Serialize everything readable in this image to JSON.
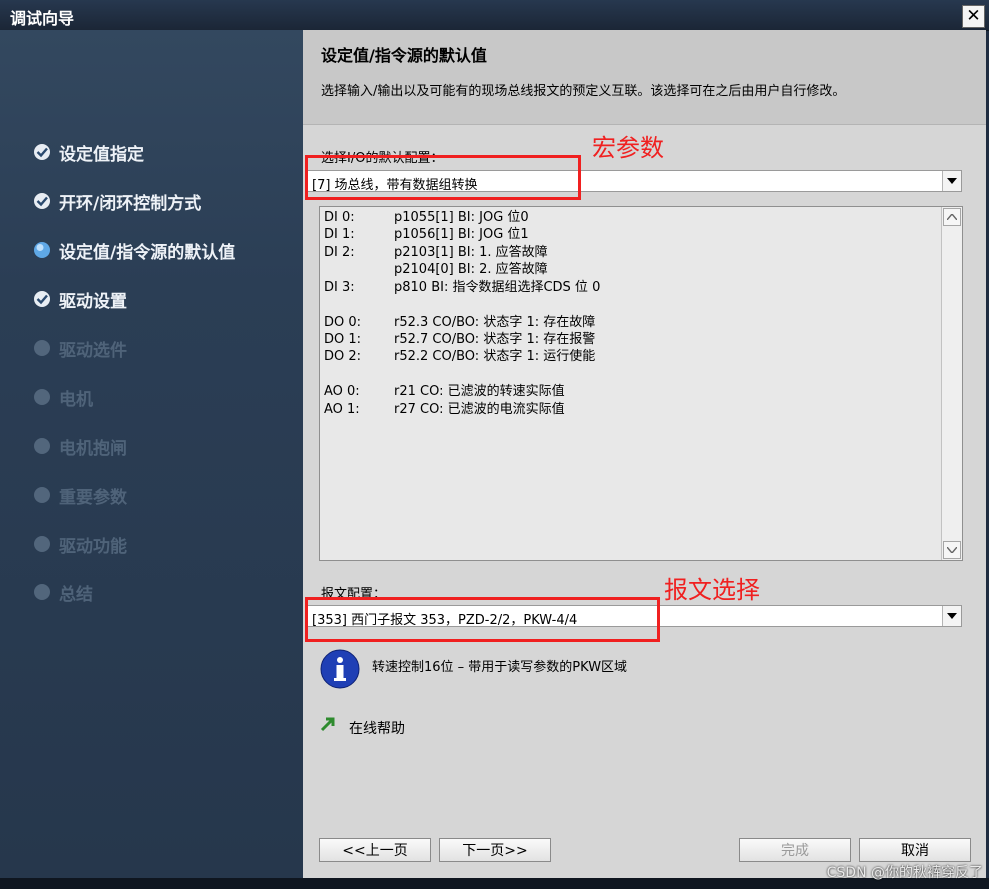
{
  "window": {
    "title": "调试向导",
    "close_label": "✕"
  },
  "sidebar": {
    "items": [
      {
        "label": "设定值指定",
        "state": "done",
        "icon": "checkmark-icon"
      },
      {
        "label": "开环/闭环控制方式",
        "state": "done",
        "icon": "checkmark-icon"
      },
      {
        "label": "设定值/指令源的默认值",
        "state": "current",
        "icon": "current-step-dot-icon"
      },
      {
        "label": "驱动设置",
        "state": "done",
        "icon": "checkmark-icon"
      },
      {
        "label": "驱动选件",
        "state": "disabled",
        "icon": "pending-dot-icon"
      },
      {
        "label": "电机",
        "state": "disabled",
        "icon": "pending-dot-icon"
      },
      {
        "label": "电机抱闸",
        "state": "disabled",
        "icon": "pending-dot-icon"
      },
      {
        "label": "重要参数",
        "state": "disabled",
        "icon": "pending-dot-icon"
      },
      {
        "label": "驱动功能",
        "state": "disabled",
        "icon": "pending-dot-icon"
      },
      {
        "label": "总结",
        "state": "disabled",
        "icon": "pending-dot-icon"
      }
    ]
  },
  "main": {
    "title": "设定值/指令源的默认值",
    "description": "选择输入/输出以及可能有的现场总线报文的预定义互联。该选择可在之后由用户自行修改。",
    "io_config": {
      "label": "选择I/O的默认配置：",
      "value": "[7] 场总线，带有数据组转换"
    },
    "io_list": [
      {
        "label": "DI 0:",
        "value": "p1055[1] BI: JOG 位0"
      },
      {
        "label": "DI 1:",
        "value": "p1056[1] BI: JOG 位1"
      },
      {
        "label": "DI 2:",
        "value": "p2103[1] BI: 1. 应答故障"
      },
      {
        "label": "",
        "value": "p2104[0] BI: 2. 应答故障"
      },
      {
        "label": "DI 3:",
        "value": "p810 BI: 指令数据组选择CDS 位 0"
      },
      {
        "label": "DO 0:",
        "value": "r52.3 CO/BO: 状态字 1: 存在故障"
      },
      {
        "label": "DO 1:",
        "value": "r52.7 CO/BO: 状态字 1: 存在报警"
      },
      {
        "label": "DO 2:",
        "value": "r52.2 CO/BO: 状态字 1: 运行使能"
      },
      {
        "label": "AO 0:",
        "value": "r21 CO: 已滤波的转速实际值"
      },
      {
        "label": "AO 1:",
        "value": "r27 CO: 已滤波的电流实际值"
      }
    ],
    "telegram_config": {
      "label": "报文配置：",
      "value": "[353] 西门子报文 353，PZD-2/2，PKW-4/4"
    },
    "info_text": "转速控制16位 – 带用于读写参数的PKW区域",
    "help_link": "在线帮助"
  },
  "annotations": {
    "macro": "宏参数",
    "telegram": "报文选择",
    "color": "#f02020"
  },
  "buttons": {
    "prev": "<<上一页",
    "next": "下一页>>",
    "finish": "完成",
    "cancel": "取消"
  },
  "watermark": "CSDN @你的秋裤穿反了",
  "colors": {
    "sidebar": "#2b3e55",
    "content": "#d6d6d6",
    "info_icon": "#1f3fb5",
    "help_arrow": "#2e8b2e"
  }
}
